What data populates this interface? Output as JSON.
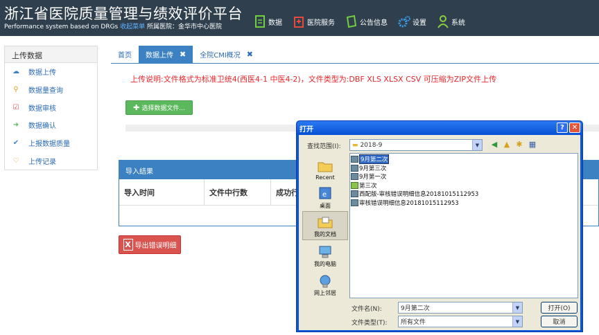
{
  "header": {
    "title": "浙江省医院质量管理与绩效评价平台",
    "subtitle_prefix": "Performance system based on DRGs",
    "menu_toggle": "收起菜单",
    "hospital_label": "所属医院：",
    "hospital_name": "金华市中心医院"
  },
  "topnav": [
    {
      "label": "数据",
      "icon": "document-icon",
      "color": "#6fcf3d"
    },
    {
      "label": "医院服务",
      "icon": "hospital-icon",
      "color": "#e64a3c"
    },
    {
      "label": "公告信息",
      "icon": "book-icon",
      "color": "#6fcf3d"
    },
    {
      "label": "设置",
      "icon": "gears-icon",
      "color": "#3aa0ea"
    },
    {
      "label": "系统",
      "icon": "user-icon",
      "color": "#8ad03c"
    }
  ],
  "sidebar": {
    "heading": "上传数据",
    "items": [
      {
        "label": "数据上传",
        "icon": "cloud-upload-icon",
        "color": "#3c82c2"
      },
      {
        "label": "数据量查询",
        "icon": "search-icon",
        "color": "#e0a020"
      },
      {
        "label": "数据审核",
        "icon": "checkbox-icon",
        "color": "#d9534f"
      },
      {
        "label": "数据确认",
        "icon": "sign-in-icon",
        "color": "#5cb85c"
      },
      {
        "label": "上报数据质量",
        "icon": "check-icon",
        "color": "#3c82c2"
      },
      {
        "label": "上传记录",
        "icon": "heart-icon",
        "color": "#e0a020"
      }
    ]
  },
  "tabs": [
    {
      "label": "首页",
      "active": false,
      "closable": false
    },
    {
      "label": "数据上传",
      "active": true,
      "closable": true
    },
    {
      "label": "全院CMI概况",
      "active": false,
      "closable": true
    }
  ],
  "upload_note": "上传说明:文件格式为标准卫统4(西医4-1 中医4-2)，文件类型为:DBF XLS XLSX CSV 可压缩为ZIP文件上传",
  "choose_button": "选择数据文件...",
  "import_panel": {
    "title": "导入结果",
    "columns": [
      "导入时间",
      "文件中行数",
      "成功行"
    ]
  },
  "export_button": "导出错误明细",
  "dialog": {
    "title": "打开",
    "lookin_label": "查找范围(I):",
    "lookin_value": "2018-9",
    "places": [
      "Recent",
      "桌面",
      "我的文档",
      "我的电脑",
      "网上邻居"
    ],
    "selected_place": "我的文档",
    "files": [
      {
        "name": "9月第二次",
        "selected": true
      },
      {
        "name": "9月第三次",
        "selected": false
      },
      {
        "name": "9月第一次",
        "selected": false
      },
      {
        "name": "第三次",
        "selected": false
      },
      {
        "name": "西配版-审核错误明细信息20181015112953",
        "selected": false
      },
      {
        "name": "审核错误明细信息20181015112953",
        "selected": false
      }
    ],
    "filename_label": "文件名(N):",
    "filename_value": "9月第二次",
    "filetype_label": "文件类型(T):",
    "filetype_value": "所有文件",
    "open_button": "打开(O)",
    "cancel_button": "取消"
  }
}
